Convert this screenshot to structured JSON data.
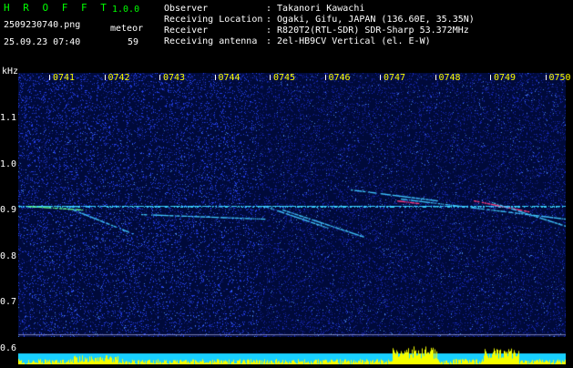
{
  "header": {
    "brand": "H R O F F T",
    "version": "1.0.0",
    "filename": "2509230740.png",
    "datetime": "25.09.23 07:40",
    "meteor_label": "meteor",
    "meteor_count": "59"
  },
  "info": [
    {
      "label": "Observer",
      "value": ": Takanori Kawachi"
    },
    {
      "label": "Receiving Location",
      "value": ": Ogaki, Gifu, JAPAN (136.60E, 35.35N)"
    },
    {
      "label": "Receiver",
      "value": ": R820T2(RTL-SDR) SDR-Sharp 53.372MHz"
    },
    {
      "label": "Receiving antenna",
      "value": ": 2el-HB9CV Vertical (el. E-W)"
    }
  ],
  "spectrogram": {
    "unit": "kHz",
    "time_labels": [
      "0741",
      "0742",
      "0743",
      "0744",
      "0745",
      "0746",
      "0747",
      "0748",
      "0749",
      "0750"
    ],
    "freq_labels": [
      "1.1",
      "1.0",
      "0.9",
      "0.8",
      "0.7",
      "0.6"
    ],
    "colors": {
      "background": "#000a3a",
      "noise": "#1e3cff",
      "carrier": "#38d0ff",
      "hot": "#ff3070",
      "ground": "#18d0ff",
      "bars": "#f5ff00",
      "text_green": "#00ff00",
      "text_white": "#ffffff"
    }
  }
}
